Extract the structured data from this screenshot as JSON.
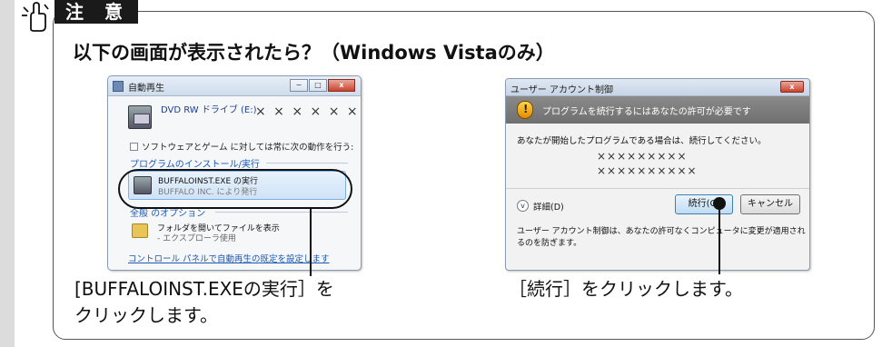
{
  "notice": {
    "badge": "注 意",
    "heading": "以下の画面が表示されたら？（Windows Vistaのみ）"
  },
  "autoplay_dialog": {
    "title": "自動再生",
    "drive_label": "DVD RW ドライブ (E:)",
    "drive_marks": "× × × × × ×",
    "checkbox_label": "ソフトウェアとゲーム に対しては常に次の動作を行う:",
    "install_section": "プログラムのインストール/実行",
    "option_line1": "BUFFALOINST.EXE の実行",
    "option_line2": "BUFFALO INC. により発行",
    "general_section": "全般 のオプション",
    "folder_line1": "フォルダを開いてファイルを表示",
    "folder_line2": "- エクスプローラ使用",
    "control_panel_link": "コントロール パネルで自動再生の既定を設定します",
    "window_buttons": [
      "−",
      "□",
      "x"
    ]
  },
  "uac_dialog": {
    "title": "ユーザー アカウント制御",
    "close_label": "x",
    "banner": "プログラムを続行するにはあなたの許可が必要です",
    "body": "あなたが開始したプログラムである場合は、続行してください。",
    "program_lines": [
      "×××××××××",
      "××××××××××"
    ],
    "details": "詳細(D)",
    "continue_button": "続行(C)",
    "cancel_button": "キャンセル",
    "footer": "ユーザー アカウント制御は、あなたの許可なくコンピュータに変更が適用されるのを防ぎます。"
  },
  "captions": {
    "left_line1": "[BUFFALOINST.EXEの実行］を",
    "left_line2": "クリックします。",
    "right": "［続行］をクリックします。"
  }
}
